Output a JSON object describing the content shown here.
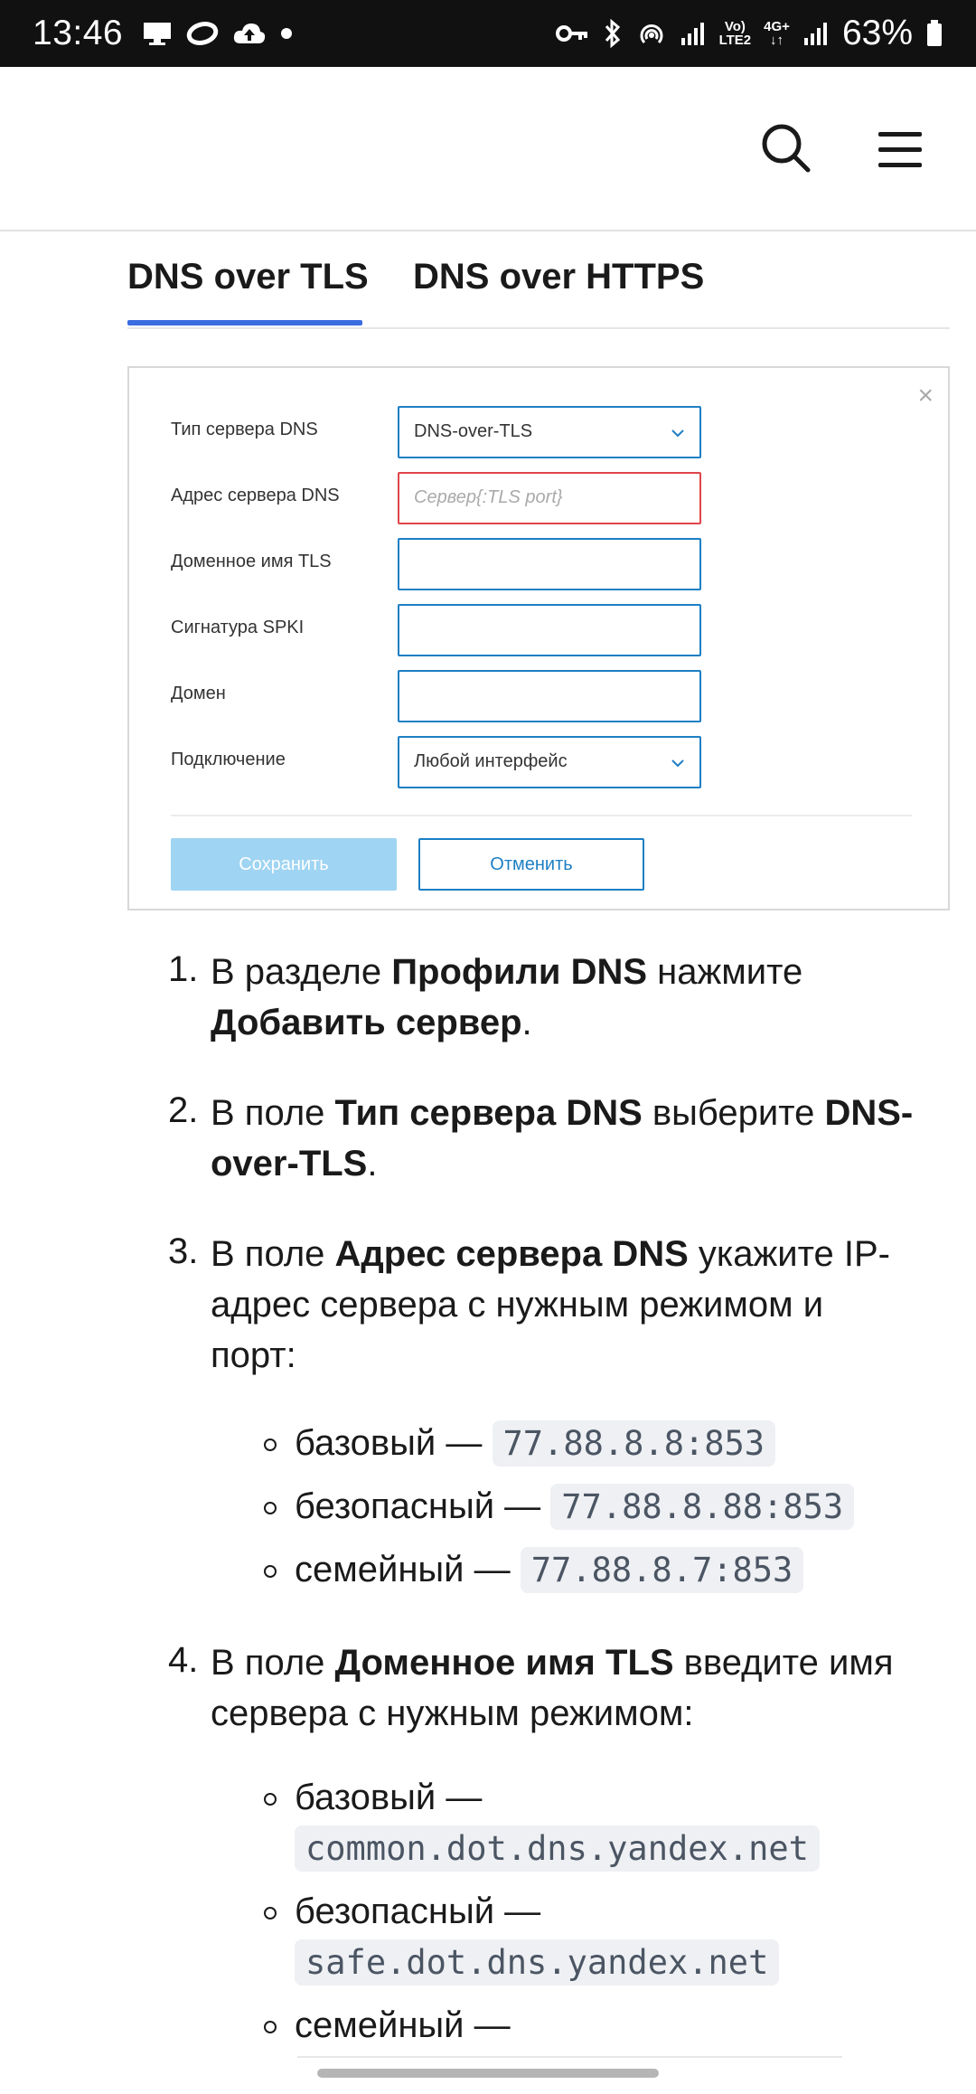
{
  "status_bar": {
    "time": "13:46",
    "battery_pct": "63%",
    "network": "4G+",
    "volte": "Vo) LTE2"
  },
  "tabs": [
    {
      "label": "DNS over TLS",
      "active": true
    },
    {
      "label": "DNS over HTTPS",
      "active": false
    }
  ],
  "form": {
    "rows": [
      {
        "label": "Тип сервера DNS",
        "value": "DNS-over-TLS",
        "type": "select"
      },
      {
        "label": "Адрес сервера DNS",
        "placeholder": "Сервер{:TLS port}",
        "type": "input-error"
      },
      {
        "label": "Доменное имя TLS",
        "value": "",
        "type": "input"
      },
      {
        "label": "Сигнатура SPKI",
        "value": "",
        "type": "input"
      },
      {
        "label": "Домен",
        "value": "",
        "type": "input"
      },
      {
        "label": "Подключение",
        "value": "Любой интерфейс",
        "type": "select"
      }
    ],
    "save_label": "Сохранить",
    "cancel_label": "Отменить"
  },
  "steps": [
    {
      "num": "1.",
      "line1_a": "В разделе ",
      "line1_b": "Профили DNS",
      "line1_c": " нажмите",
      "line2_b": "Добавить сервер",
      "line2_c": "."
    },
    {
      "num": "2.",
      "line1_a": "В поле ",
      "line1_b": "Тип сервера DNS",
      "line1_c": " выберите ",
      "line1_d": "DNS-",
      "line2_b": "over-TLS",
      "line2_c": "."
    },
    {
      "num": "3.",
      "line1_a": "В поле ",
      "line1_b": "Адрес сервера DNS",
      "line1_c": " укажите IP-",
      "line2": "адрес сервера с нужным режимом и",
      "line3": "порт:"
    },
    {
      "num": "4.",
      "line1_a": "В поле ",
      "line1_b": "Доменное имя TLS",
      "line1_c": " введите имя",
      "line2": "сервера с нужным режимом:"
    }
  ],
  "ip_list": [
    {
      "label": "базовый — ",
      "code": "77.88.8.8:853"
    },
    {
      "label": "безопасный — ",
      "code": "77.88.8.88:853"
    },
    {
      "label": "семейный — ",
      "code": "77.88.8.7:853"
    }
  ],
  "host_list": [
    {
      "label": "базовый —",
      "code": "common.dot.dns.yandex.net"
    },
    {
      "label": "безопасный —",
      "code": "safe.dot.dns.yandex.net"
    },
    {
      "label": "семейный —",
      "code": ""
    }
  ]
}
